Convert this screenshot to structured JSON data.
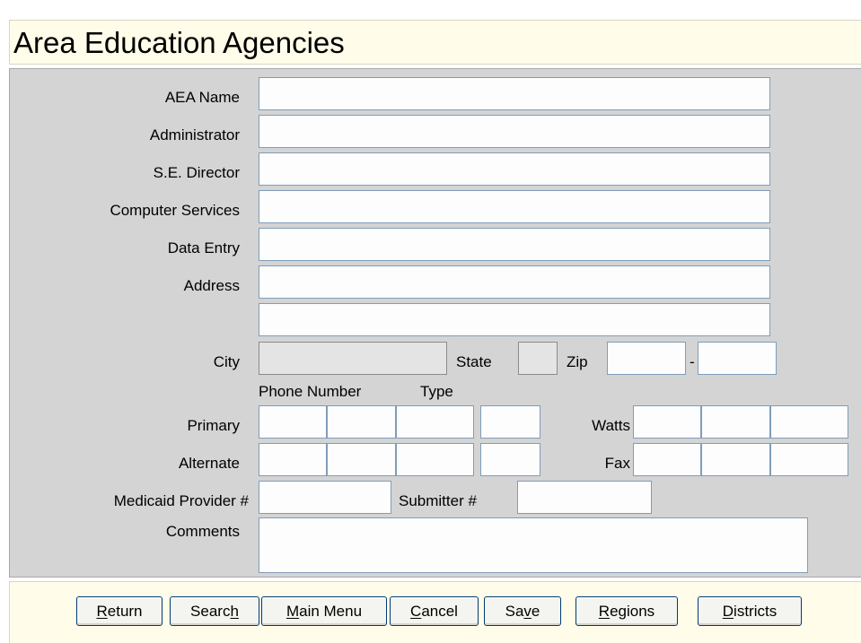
{
  "page": {
    "title": "Area Education Agencies"
  },
  "labels": {
    "aea_name": "AEA Name",
    "administrator": "Administrator",
    "se_director": "S.E. Director",
    "computer_services": "Computer Services",
    "data_entry": "Data Entry",
    "address": "Address",
    "city": "City",
    "state": "State",
    "zip": "Zip",
    "zip_sep": "-",
    "phone_number": "Phone Number",
    "type": "Type",
    "primary": "Primary",
    "alternate": "Alternate",
    "watts": "Watts",
    "fax": "Fax",
    "medicaid": "Medicaid Provider #",
    "submitter": "Submitter #",
    "comments": "Comments"
  },
  "fields": {
    "aea_name": "",
    "administrator": "",
    "se_director": "",
    "computer_services": "",
    "data_entry": "",
    "address1": "",
    "address2": "",
    "city": "",
    "state": "",
    "zip": "",
    "zip_ext": "",
    "medicaid": "",
    "submitter": "",
    "comments": ""
  },
  "buttons": [
    {
      "pre": "",
      "key": "R",
      "post": "eturn"
    },
    {
      "pre": "Searc",
      "key": "h",
      "post": ""
    },
    {
      "pre": "",
      "key": "M",
      "post": "ain Menu"
    },
    {
      "pre": "",
      "key": "C",
      "post": "ancel"
    },
    {
      "pre": "Sa",
      "key": "v",
      "post": "e"
    },
    {
      "pre": "",
      "key": "R",
      "post": "egions"
    },
    {
      "pre": "",
      "key": "D",
      "post": "istricts"
    }
  ]
}
